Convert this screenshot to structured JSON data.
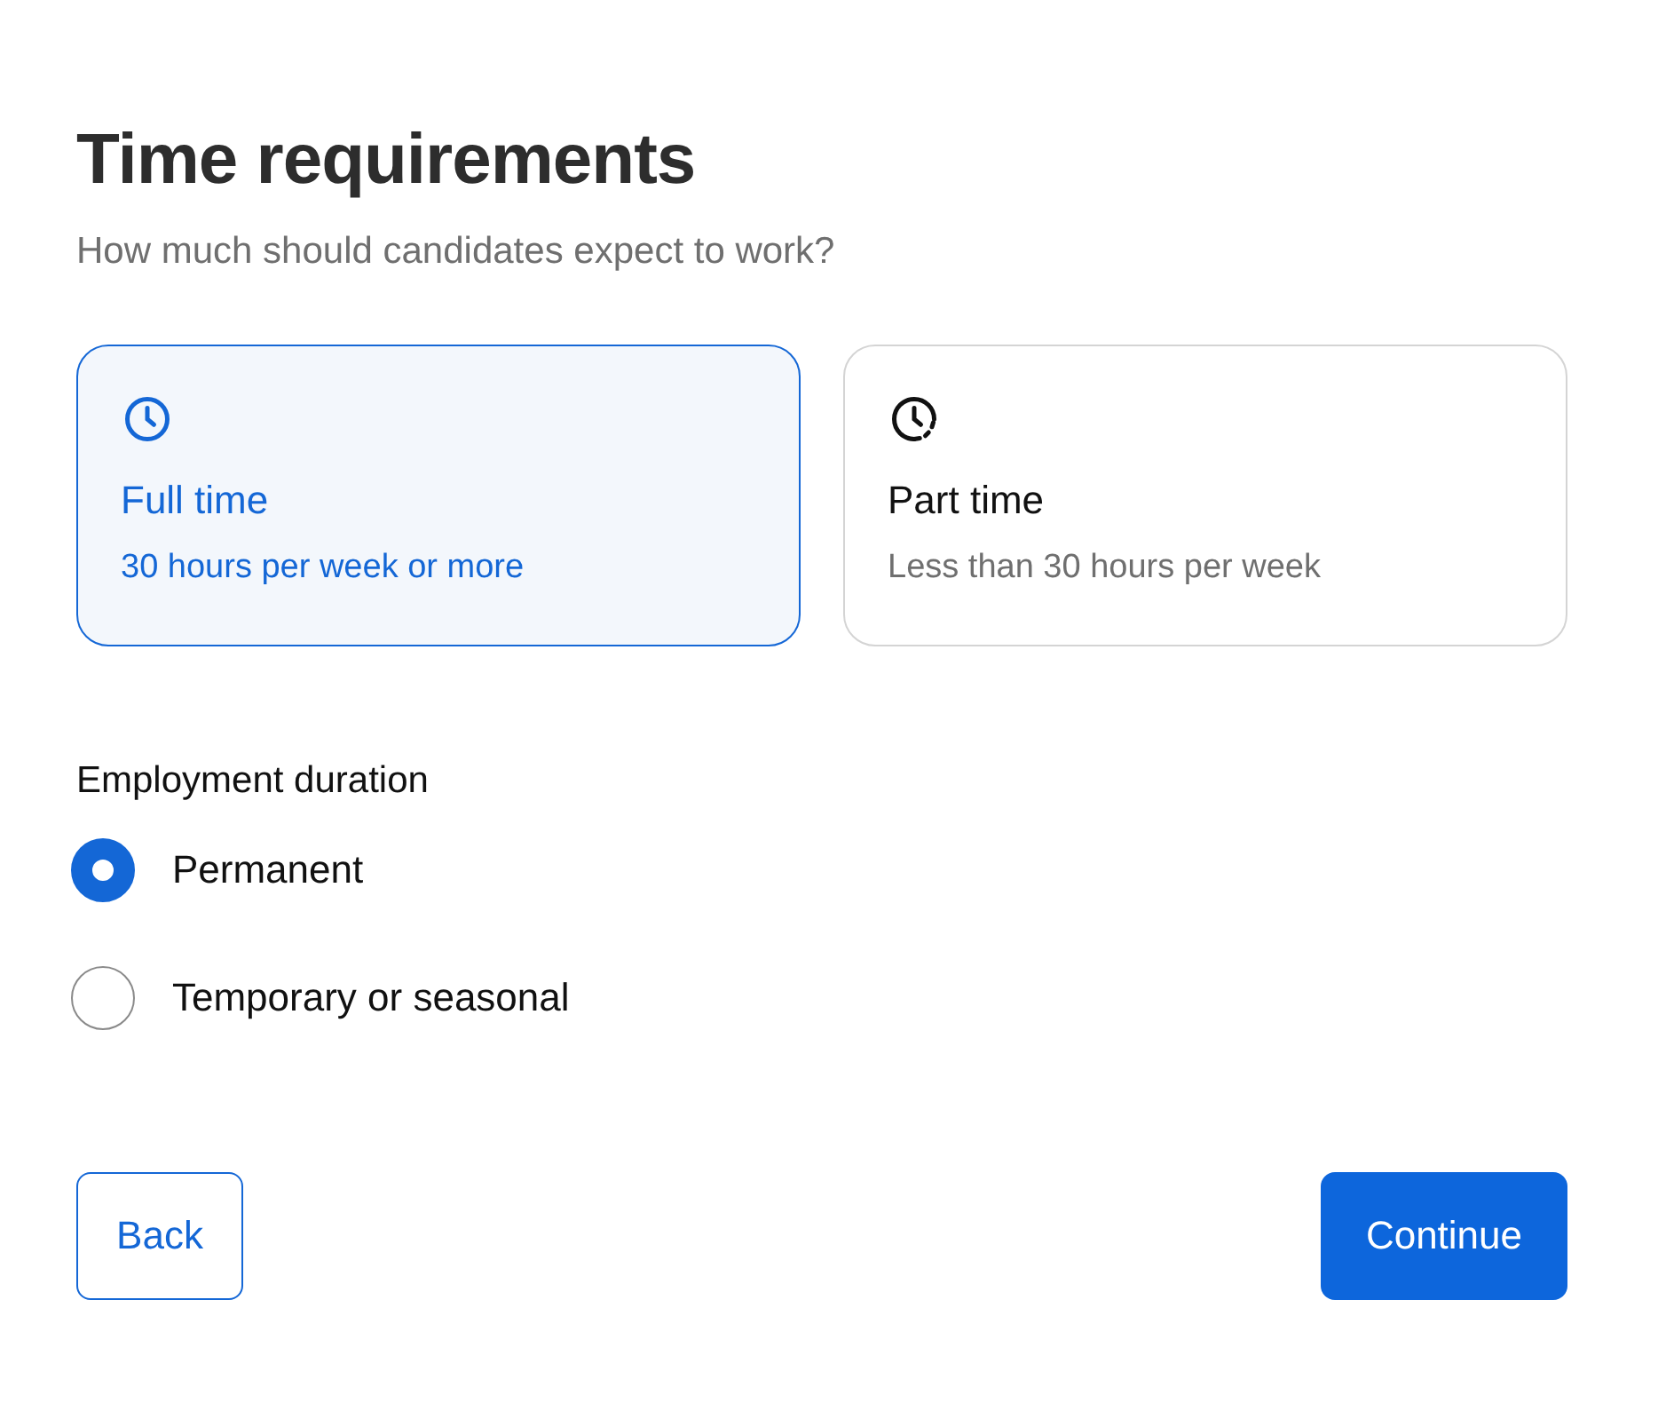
{
  "title": "Time requirements",
  "subtitle": "How much should candidates expect to work?",
  "time_options": [
    {
      "kind": "full",
      "label": "Full time",
      "description": "30 hours per week or more",
      "selected": true
    },
    {
      "kind": "part",
      "label": "Part time",
      "description": "Less than 30 hours per week",
      "selected": false
    }
  ],
  "duration": {
    "label": "Employment duration",
    "options": [
      {
        "label": "Permanent",
        "selected": true
      },
      {
        "label": "Temporary or seasonal",
        "selected": false
      }
    ]
  },
  "buttons": {
    "back": "Back",
    "continue": "Continue"
  }
}
